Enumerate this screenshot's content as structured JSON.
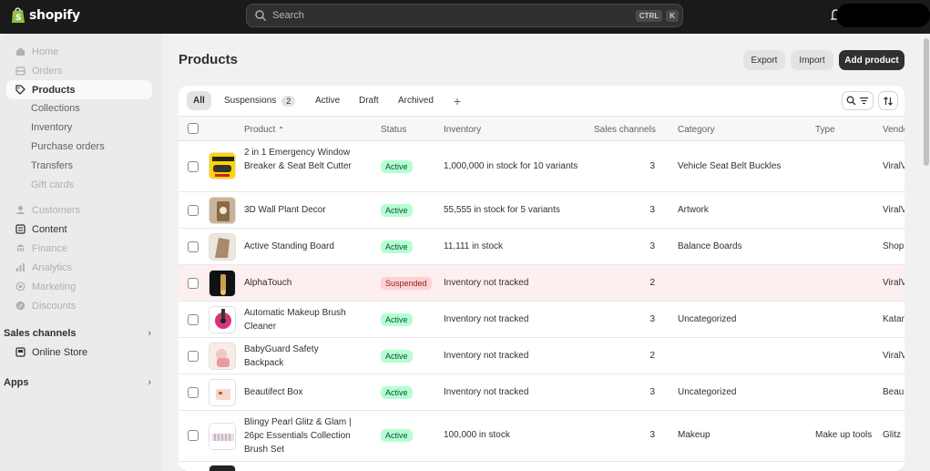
{
  "topbar": {
    "logo_text": "shopify",
    "search_placeholder": "Search",
    "kbd_ctrl": "CTRL",
    "kbd_k": "K"
  },
  "sidebar": {
    "home": "Home",
    "orders": "Orders",
    "products": "Products",
    "collections": "Collections",
    "inventory": "Inventory",
    "purchase_orders": "Purchase orders",
    "transfers": "Transfers",
    "gift_cards": "Gift cards",
    "customers": "Customers",
    "content": "Content",
    "finance": "Finance",
    "analytics": "Analytics",
    "marketing": "Marketing",
    "discounts": "Discounts",
    "sales_channels": "Sales channels",
    "online_store": "Online Store",
    "apps": "Apps"
  },
  "page": {
    "title": "Products",
    "export": "Export",
    "import": "Import",
    "add_product": "Add product"
  },
  "tabs": {
    "all": "All",
    "suspensions": "Suspensions",
    "suspensions_count": "2",
    "active": "Active",
    "draft": "Draft",
    "archived": "Archived",
    "add": "+"
  },
  "columns": {
    "product": "Product",
    "status": "Status",
    "inventory": "Inventory",
    "sales_channels": "Sales channels",
    "category": "Category",
    "type": "Type",
    "vendor": "Vendor"
  },
  "rows": [
    {
      "name": "2 in 1 Emergency Window Breaker & Seat Belt Cutter",
      "status": "Active",
      "inventory": "1,000,000 in stock for 10 variants",
      "channels": "3",
      "category": "Vehicle Seat Belt Buckles",
      "type": "",
      "vendor": "ViralV"
    },
    {
      "name": "3D Wall Plant Decor",
      "status": "Active",
      "inventory": "55,555 in stock for 5 variants",
      "channels": "3",
      "category": "Artwork",
      "type": "",
      "vendor": "ViralV"
    },
    {
      "name": "Active Standing Board",
      "status": "Active",
      "inventory": "11,111 in stock",
      "channels": "3",
      "category": "Balance Boards",
      "type": "",
      "vendor": "Shop"
    },
    {
      "name": "AlphaTouch",
      "status": "Suspended",
      "inventory": "Inventory not tracked",
      "channels": "2",
      "category": "",
      "type": "",
      "vendor": "ViralV"
    },
    {
      "name": "Automatic Makeup Brush Cleaner",
      "status": "Active",
      "inventory": "Inventory not tracked",
      "channels": "3",
      "category": "Uncategorized",
      "type": "",
      "vendor": "Katar"
    },
    {
      "name": "BabyGuard Safety Backpack",
      "status": "Active",
      "inventory": "Inventory not tracked",
      "channels": "2",
      "category": "",
      "type": "",
      "vendor": "ViralV"
    },
    {
      "name": "Beautifect Box",
      "status": "Active",
      "inventory": "Inventory not tracked",
      "channels": "3",
      "category": "Uncategorized",
      "type": "",
      "vendor": "Beau"
    },
    {
      "name": "Blingy Pearl Glitz & Glam | 26pc Essentials Collection Brush Set",
      "status": "Active",
      "inventory": "100,000 in stock",
      "channels": "3",
      "category": "Makeup",
      "type": "Make up tools",
      "vendor": "Glitz"
    }
  ]
}
